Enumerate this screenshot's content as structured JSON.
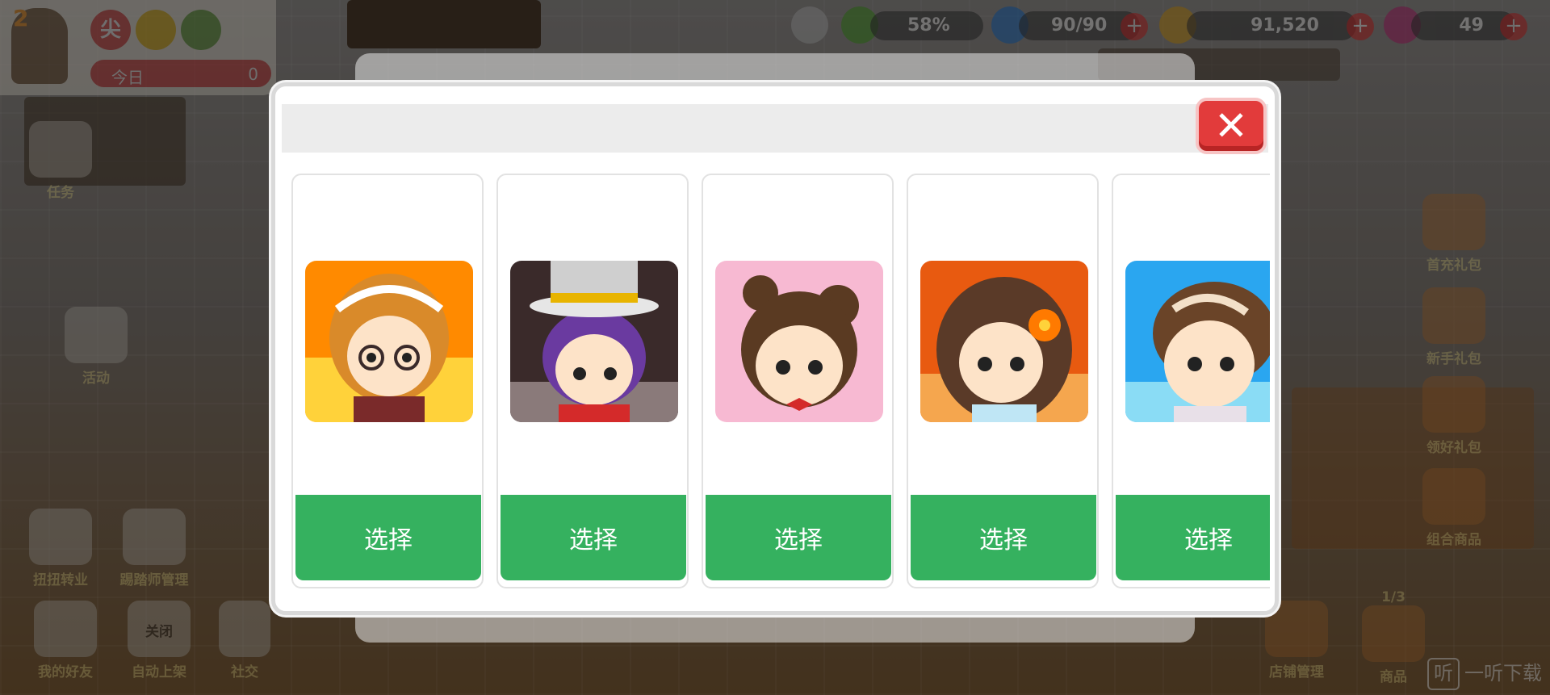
{
  "player": {
    "level": "2",
    "tag": "尖",
    "today_label": "今日",
    "today_value": "0"
  },
  "resources": {
    "exp_percent": "58%",
    "energy": "90/90",
    "coins": "91,520",
    "gems": "49"
  },
  "left_menu": [
    "任务",
    "活动",
    "扭扭转业",
    "踢踏师管理",
    "我的好友",
    "关闭",
    "自动上架",
    "社交"
  ],
  "right_menu": [
    "首充礼包",
    "新手礼包",
    "领好礼包",
    "组合商品",
    "1/3",
    "商品",
    "店铺管理"
  ],
  "watermark": {
    "icon_text": "听",
    "text": "一听下载"
  },
  "modal": {
    "close_icon": "close-icon",
    "cards": [
      {
        "button": "选择",
        "bg": "#ff8a00",
        "hair": "#d98a2a"
      },
      {
        "button": "选择",
        "bg": "#3a2a2a",
        "hair": "#6a3aa0"
      },
      {
        "button": "选择",
        "bg": "#f7b9d2",
        "hair": "#5a3a22"
      },
      {
        "button": "选择",
        "bg": "#e85a10",
        "hair": "#5a3a28"
      },
      {
        "button": "选择",
        "bg": "#2aa6f0",
        "hair": "#6a4428"
      }
    ]
  }
}
